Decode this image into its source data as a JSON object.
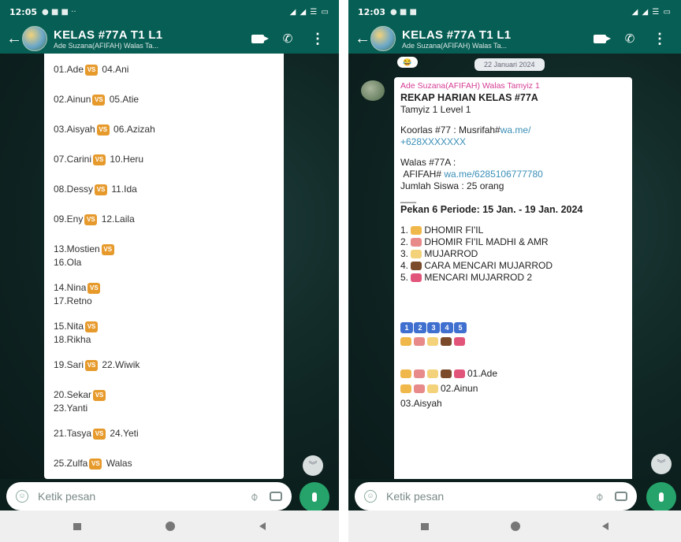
{
  "left": {
    "status_time": "12:05",
    "status_icons": "● ■ ■ ··",
    "status_right": "◢ ◢ ☰ ▭",
    "chat_title": "KELAS #77A T1 L1",
    "chat_subtitle": "Ade Suzana(AFIFAH) Walas Ta...",
    "list": [
      {
        "a": "01.Ade",
        "b": "04.Ani",
        "two_line": false
      },
      {
        "a": "02.Ainun",
        "b": "05.Atie",
        "two_line": false
      },
      {
        "a": "03.Aisyah",
        "b": "06.Azizah",
        "two_line": false
      },
      {
        "a": "07.Carini",
        "b": "10.Heru",
        "two_line": false
      },
      {
        "a": "08.Dessy",
        "b": "11.Ida",
        "two_line": false
      },
      {
        "a": "09.Eny",
        "b": "12.Laila",
        "two_line": false
      },
      {
        "a": "13.Mostien",
        "b": "16.Ola",
        "two_line": true
      },
      {
        "a": "14.Nina",
        "b": "17.Retno",
        "two_line": true
      },
      {
        "a": "15.Nita",
        "b": "18.Rikha",
        "two_line": true
      },
      {
        "a": "19.Sari",
        "b": "22.Wiwik",
        "two_line": false
      },
      {
        "a": "20.Sekar",
        "b": "23.Yanti",
        "two_line": true
      },
      {
        "a": "21.Tasya",
        "b": "24.Yeti",
        "two_line": false
      },
      {
        "a": "25.Zulfa",
        "b": "Walas",
        "two_line": false
      }
    ],
    "vs_label": "VS",
    "input_placeholder": "Ketik pesan"
  },
  "right": {
    "status_time": "12:03",
    "status_icons": "● ■ ■",
    "status_right": "◢ ◢ ☰ ▭",
    "chat_title": "KELAS #77A T1 L1",
    "chat_subtitle": "Ade Suzana(AFIFAH) Walas Ta...",
    "date_chip": "22 Januari 2024",
    "reaction": "😂",
    "sender": "Ade Suzana(AFIFAH) Walas Tamyiz 1",
    "heading": "REKAP HARIAN KELAS #77A",
    "level": "Tamyiz 1 Level 1",
    "koorlas_prefix": "Koorlas #77 : Musrifah#",
    "koorlas_link": "wa.me/",
    "koorlas_number": "+628XXXXXXX",
    "walas_label": "Walas #77A :",
    "walas_name": "AFIFAH#",
    "walas_link": "wa.me/6285106777780",
    "jumlah": "Jumlah Siswa : 25 orang",
    "separator": "___",
    "pekan": "Pekan 6 Periode: 15 Jan. - 19 Jan. 2024",
    "topics": [
      {
        "num": "1.",
        "text": "DHOMIR FI'IL",
        "color": "#f0b84a"
      },
      {
        "num": "2.",
        "text": "DHOMIR FI'IL MADHI & AMR",
        "color": "#e88a8a"
      },
      {
        "num": "3.",
        "text": "MUJARROD",
        "color": "#f3d27a"
      },
      {
        "num": "4.",
        "text": "CARA MENCARI MUJARROD",
        "color": "#7a4a2a"
      },
      {
        "num": "5.",
        "text": "MENCARI MUJARROD 2",
        "color": "#e2557a"
      }
    ],
    "keycaps": [
      "1",
      "2",
      "3",
      "4",
      "5"
    ],
    "progress": [
      {
        "name": "01.Ade",
        "count": 5
      },
      {
        "name": "02.Ainun",
        "count": 3
      },
      {
        "name": "03.Aisyah",
        "count": 0
      }
    ],
    "input_placeholder": "Ketik pesan"
  }
}
